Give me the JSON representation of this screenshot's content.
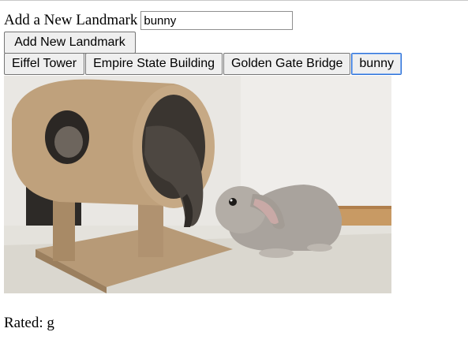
{
  "form": {
    "label": "Add a New Landmark",
    "input_value": "bunny",
    "add_button_label": "Add New Landmark"
  },
  "landmarks": [
    {
      "label": "Eiffel Tower",
      "active": false
    },
    {
      "label": "Empire State Building",
      "active": false
    },
    {
      "label": "Golden Gate Bridge",
      "active": false
    },
    {
      "label": "bunny",
      "active": true
    }
  ],
  "image": {
    "subject": "cat in carpeted cat tree tunnel and gray lop-eared bunny"
  },
  "rating": {
    "text": "Rated: g"
  },
  "colors": {
    "active_tab_border": "#2a6fd6",
    "button_background": "#efefef"
  }
}
